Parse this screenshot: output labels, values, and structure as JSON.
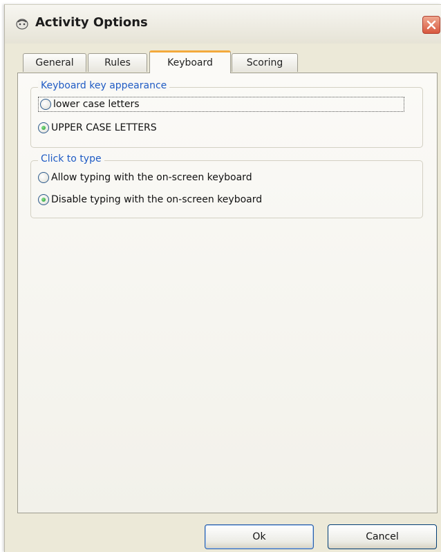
{
  "window": {
    "title": "Activity Options",
    "app_icon": "dialog-app-icon",
    "close_icon": "close-icon"
  },
  "tabs": [
    {
      "label": "General",
      "active": false
    },
    {
      "label": "Rules",
      "active": false
    },
    {
      "label": "Keyboard",
      "active": true
    },
    {
      "label": "Scoring",
      "active": false
    }
  ],
  "keyboard_appearance": {
    "legend": "Keyboard key appearance",
    "options": [
      {
        "label": "lower case letters",
        "checked": false
      },
      {
        "label": "UPPER CASE LETTERS",
        "checked": true
      }
    ]
  },
  "click_to_type": {
    "legend": "Click to type",
    "options": [
      {
        "label": "Allow typing with the on-screen keyboard",
        "checked": false
      },
      {
        "label": "Disable typing with the on-screen keyboard",
        "checked": true
      }
    ]
  },
  "buttons": {
    "ok": "Ok",
    "cancel": "Cancel"
  },
  "colors": {
    "accent_tab": "#f3a93c",
    "legend_text": "#1f5bc4",
    "radio_checked": "#1e9a32",
    "close_button": "#d8583e"
  }
}
